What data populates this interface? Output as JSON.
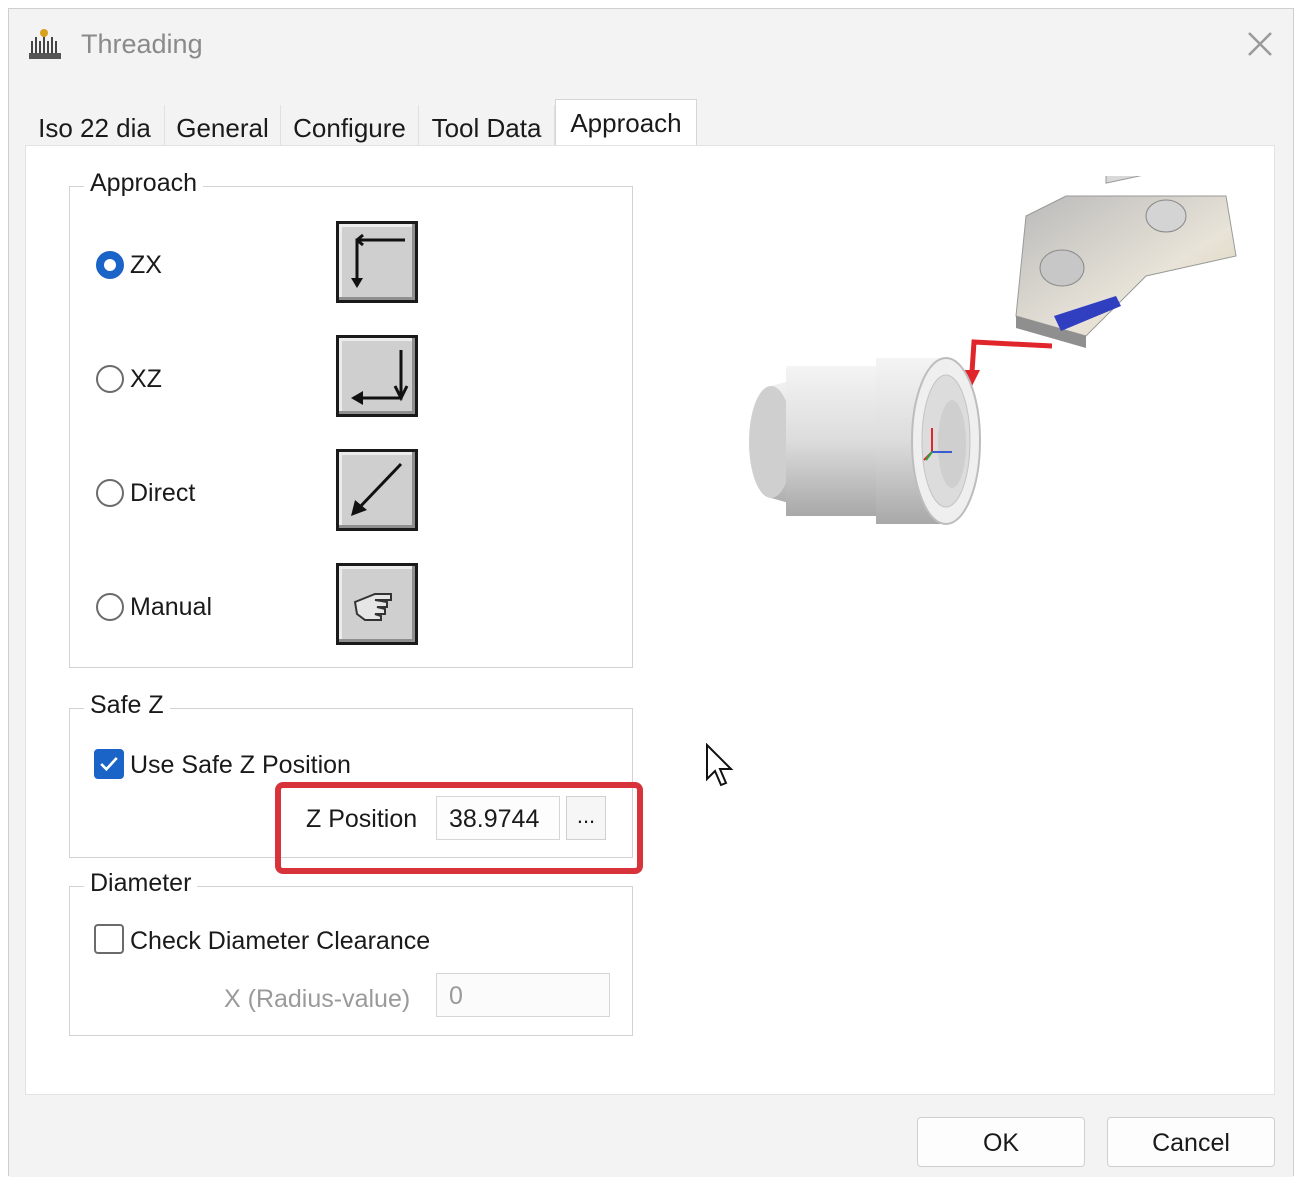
{
  "window": {
    "title": "Threading",
    "close_icon": "close-icon",
    "app_icon": "threading-app-icon"
  },
  "tabs": [
    {
      "label": "Iso 22 dia",
      "active": false
    },
    {
      "label": "General",
      "active": false
    },
    {
      "label": "Configure",
      "active": false
    },
    {
      "label": "Tool Data",
      "active": false
    },
    {
      "label": "Approach",
      "active": true
    }
  ],
  "approach_group": {
    "label": "Approach",
    "options": [
      {
        "label": "ZX",
        "checked": true,
        "icon": "zx-path-icon"
      },
      {
        "label": "XZ",
        "checked": false,
        "icon": "xz-path-icon"
      },
      {
        "label": "Direct",
        "checked": false,
        "icon": "direct-path-icon"
      },
      {
        "label": "Manual",
        "checked": false,
        "icon": "hand-pointer-icon"
      }
    ]
  },
  "safe_z_group": {
    "label": "Safe Z",
    "use_safe_z_label": "Use Safe Z Position",
    "use_safe_z_checked": true,
    "z_position_label": "Z Position",
    "z_position_value": "38.9744",
    "browse_label": "...",
    "highlight_color": "#d8333b"
  },
  "diameter_group": {
    "label": "Diameter",
    "check_label": "Check Diameter Clearance",
    "check_checked": false,
    "x_label": "X (Radius-value)",
    "x_value": "0"
  },
  "buttons": {
    "ok": "OK",
    "cancel": "Cancel"
  },
  "colors": {
    "accent": "#1b64c7",
    "approach_arrow": "#e0262b",
    "insert": "#2f3fc0"
  }
}
